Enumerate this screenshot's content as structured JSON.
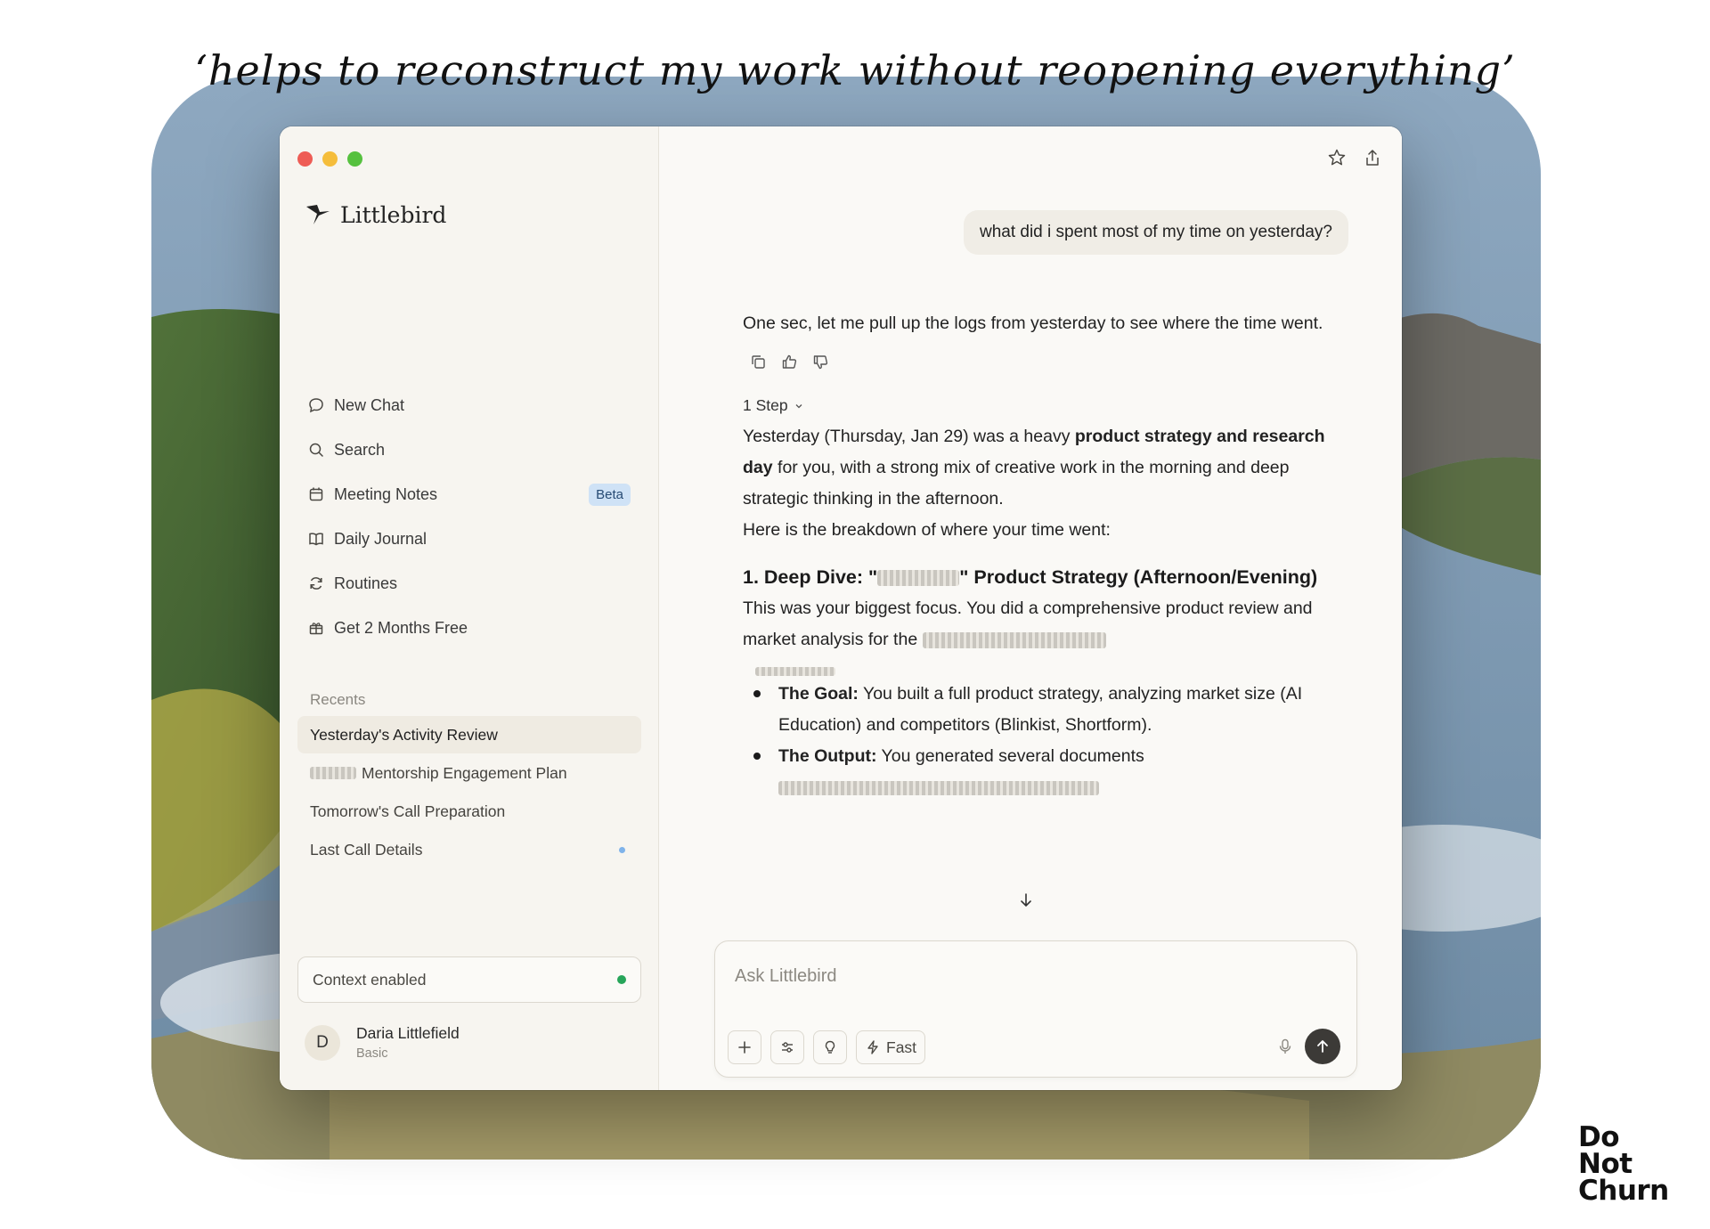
{
  "tagline": "‘helps to reconstruct my work without reopening everything’",
  "app": {
    "name": "Littlebird"
  },
  "sidebar": {
    "nav": [
      {
        "label": "New Chat",
        "icon": "chat-bubble-icon"
      },
      {
        "label": "Search",
        "icon": "search-icon"
      },
      {
        "label": "Meeting Notes",
        "icon": "calendar-icon",
        "badge": "Beta"
      },
      {
        "label": "Daily Journal",
        "icon": "book-icon"
      },
      {
        "label": "Routines",
        "icon": "refresh-icon"
      },
      {
        "label": "Get 2 Months Free",
        "icon": "gift-icon"
      }
    ],
    "recents_title": "Recents",
    "recents": [
      {
        "label": "Yesterday's Activity Review",
        "active": true
      },
      {
        "label": "Mentorship Engagement Plan",
        "redacted_prefix": true
      },
      {
        "label": "Tomorrow's Call Preparation"
      },
      {
        "label": "Last Call Details",
        "unread": true
      }
    ],
    "context": {
      "label": "Context enabled",
      "status_color": "#27a55a"
    },
    "user": {
      "initial": "D",
      "name": "Daria Littlefield",
      "plan": "Basic"
    }
  },
  "chat": {
    "user_message": "what did i spent most of my time on yesterday?",
    "intro": "One sec, let me pull up the logs from yesterday to see where the time went.",
    "step": "1 Step",
    "summary_pre": "Yesterday (Thursday, Jan 29) was a heavy ",
    "summary_bold": "product strategy and research day",
    "summary_post": " for you, with a strong mix of creative work in the morning and deep strategic thinking in the afternoon.",
    "breakdown_intro": "Here is the breakdown of where your time went:",
    "section1_pre": "1. Deep Dive: \"",
    "section1_post": "\" Product Strategy (Afternoon/Evening)",
    "section1_body": "This was your biggest focus. You did a comprehensive product review and market analysis for the ",
    "bullets": [
      {
        "bold": "The Goal:",
        "text": " You built a full product strategy, analyzing market size (AI Education) and competitors (Blinkist, Shortform)."
      },
      {
        "bold": "The Output:",
        "text": " You generated several documents"
      }
    ]
  },
  "composer": {
    "placeholder": "Ask Littlebird",
    "mode_label": "Fast"
  },
  "logo": {
    "line1": "Do",
    "line2": "Not",
    "line3": "Churn"
  }
}
